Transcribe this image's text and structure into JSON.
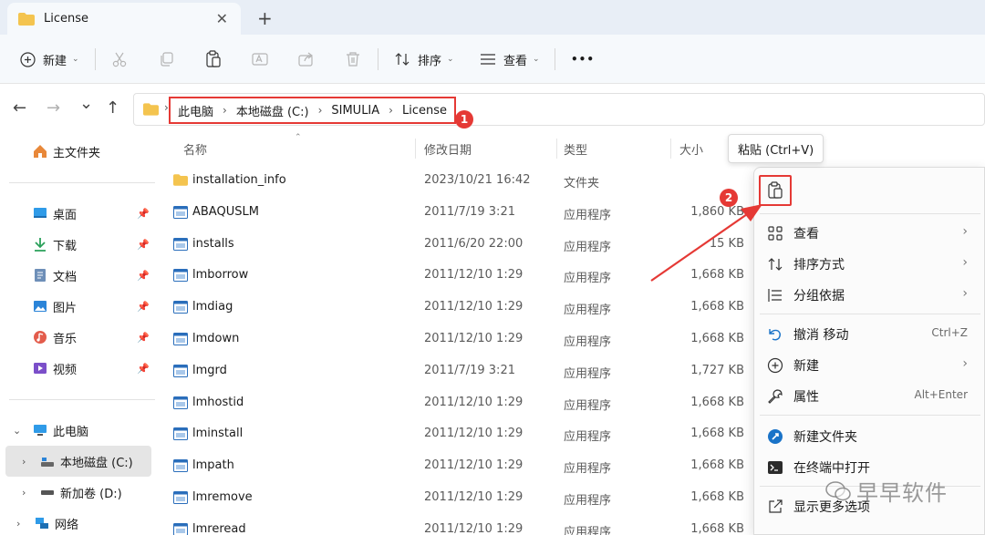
{
  "tab": {
    "title": "License",
    "close": "✕",
    "new_tab": "+"
  },
  "toolbar": {
    "new_label": "新建",
    "sort_label": "排序",
    "view_label": "查看",
    "more": "•••"
  },
  "nav": {
    "back": "←",
    "forward": "→",
    "recent": "⌄",
    "up": "↑"
  },
  "breadcrumb": [
    "此电脑",
    "本地磁盘 (C:)",
    "SIMULIA",
    "License"
  ],
  "badges": {
    "one": "1",
    "two": "2"
  },
  "sidebar": {
    "home": "主文件夹",
    "quick": [
      {
        "label": "桌面"
      },
      {
        "label": "下载"
      },
      {
        "label": "文档"
      },
      {
        "label": "图片"
      },
      {
        "label": "音乐"
      },
      {
        "label": "视频"
      }
    ],
    "this_pc": "此电脑",
    "local_disk": "本地磁盘 (C:)",
    "new_volume": "新加卷 (D:)",
    "network": "网络"
  },
  "columns": {
    "name": "名称",
    "modified": "修改日期",
    "type": "类型",
    "size": "大小"
  },
  "files": [
    {
      "name": "installation_info",
      "date": "2023/10/21 16:42",
      "type": "文件夹",
      "size": "",
      "kind": "folder"
    },
    {
      "name": "ABAQUSLM",
      "date": "2011/7/19 3:21",
      "type": "应用程序",
      "size": "1,860 KB",
      "kind": "app"
    },
    {
      "name": "installs",
      "date": "2011/6/20 22:00",
      "type": "应用程序",
      "size": "15 KB",
      "kind": "app"
    },
    {
      "name": "lmborrow",
      "date": "2011/12/10 1:29",
      "type": "应用程序",
      "size": "1,668 KB",
      "kind": "app"
    },
    {
      "name": "lmdiag",
      "date": "2011/12/10 1:29",
      "type": "应用程序",
      "size": "1,668 KB",
      "kind": "app"
    },
    {
      "name": "lmdown",
      "date": "2011/12/10 1:29",
      "type": "应用程序",
      "size": "1,668 KB",
      "kind": "app"
    },
    {
      "name": "lmgrd",
      "date": "2011/7/19 3:21",
      "type": "应用程序",
      "size": "1,727 KB",
      "kind": "app"
    },
    {
      "name": "lmhostid",
      "date": "2011/12/10 1:29",
      "type": "应用程序",
      "size": "1,668 KB",
      "kind": "app"
    },
    {
      "name": "lminstall",
      "date": "2011/12/10 1:29",
      "type": "应用程序",
      "size": "1,668 KB",
      "kind": "app"
    },
    {
      "name": "lmpath",
      "date": "2011/12/10 1:29",
      "type": "应用程序",
      "size": "1,668 KB",
      "kind": "app"
    },
    {
      "name": "lmremove",
      "date": "2011/12/10 1:29",
      "type": "应用程序",
      "size": "1,668 KB",
      "kind": "app"
    },
    {
      "name": "lmreread",
      "date": "2011/12/10 1:29",
      "type": "应用程序",
      "size": "1,668 KB",
      "kind": "app"
    }
  ],
  "tooltip": "粘贴 (Ctrl+V)",
  "context_menu": {
    "view": "查看",
    "sort_by": "排序方式",
    "group_by": "分组依据",
    "undo": "撤消 移动",
    "undo_shortcut": "Ctrl+Z",
    "new": "新建",
    "properties": "属性",
    "properties_shortcut": "Alt+Enter",
    "new_folder": "新建文件夹",
    "open_terminal": "在终端中打开",
    "more_options": "显示更多选项",
    "submenu_arrow": "›"
  },
  "watermark": "早早软件",
  "colors": {
    "accent": "#e53935",
    "folder": "#f4c44f",
    "app": "#2a6ebb"
  }
}
